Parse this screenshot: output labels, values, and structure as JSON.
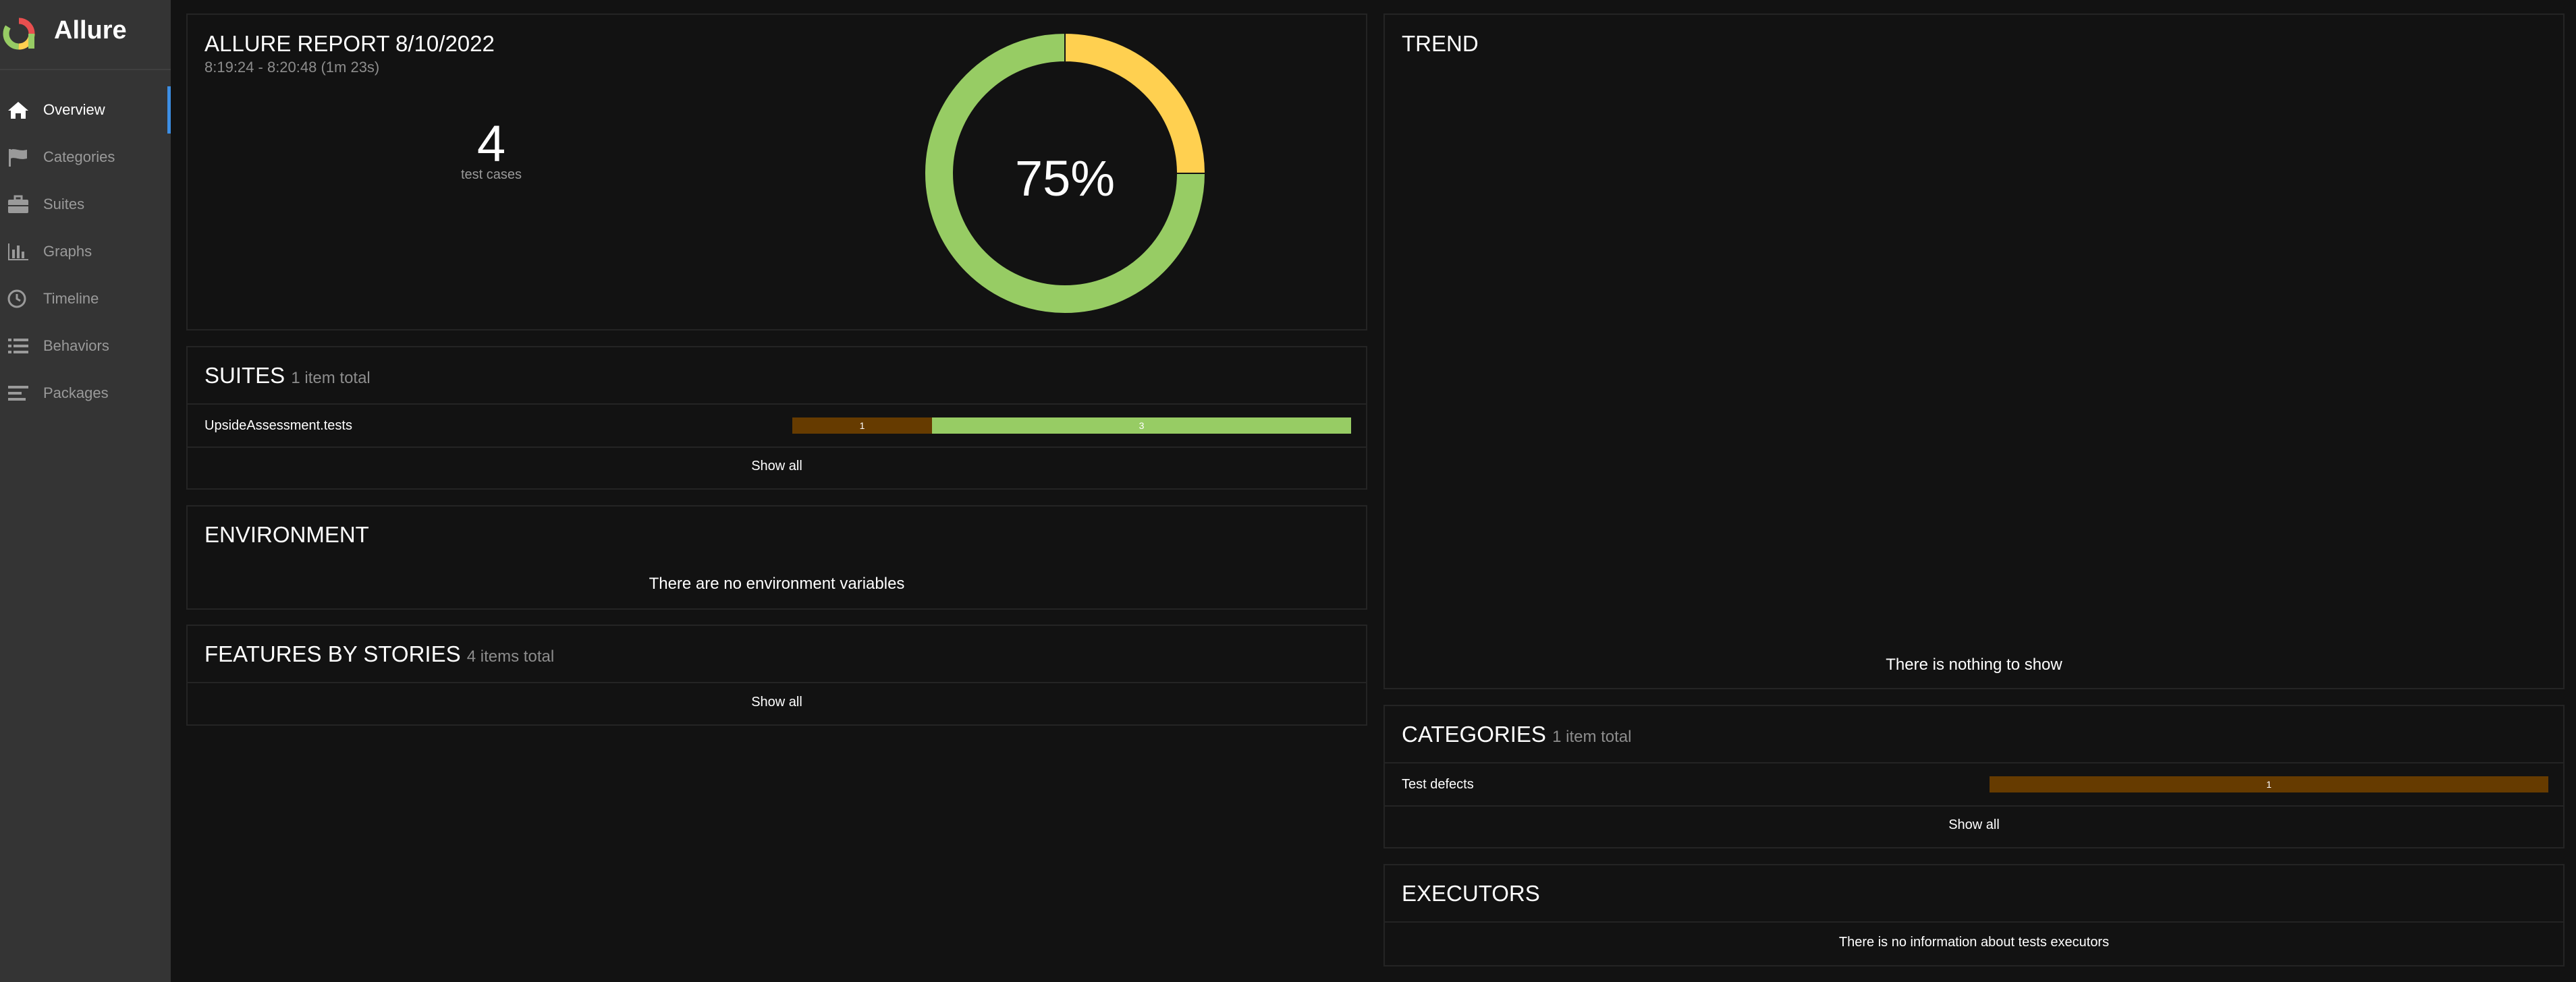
{
  "app": {
    "name": "Allure"
  },
  "colors": {
    "passed": "#97cc64",
    "broken": "#ffd050",
    "defects": "#663b00",
    "accent": "#3d8ee3"
  },
  "sidebar": {
    "items": [
      {
        "label": "Overview",
        "icon": "home-icon",
        "active": true
      },
      {
        "label": "Categories",
        "icon": "flag-icon",
        "active": false
      },
      {
        "label": "Suites",
        "icon": "briefcase-icon",
        "active": false
      },
      {
        "label": "Graphs",
        "icon": "bar-chart-icon",
        "active": false
      },
      {
        "label": "Timeline",
        "icon": "clock-icon",
        "active": false
      },
      {
        "label": "Behaviors",
        "icon": "list-icon",
        "active": false
      },
      {
        "label": "Packages",
        "icon": "align-left-icon",
        "active": false
      }
    ]
  },
  "summary": {
    "title": "ALLURE REPORT 8/10/2022",
    "time": "8:19:24 - 8:20:48 (1m 23s)",
    "count": "4",
    "count_label": "test cases",
    "percent": "75%",
    "donut": {
      "passed_fraction": 0.75,
      "broken_fraction": 0.25
    }
  },
  "suites": {
    "title": "SUITES",
    "count": "1 item total",
    "rows": [
      {
        "name": "UpsideAssessment.tests",
        "broken": 1,
        "passed": 3,
        "broken_label": "1",
        "passed_label": "3"
      }
    ],
    "show_all": "Show all"
  },
  "environment": {
    "title": "ENVIRONMENT",
    "message": "There are no environment variables"
  },
  "features": {
    "title": "FEATURES BY STORIES",
    "count": "4 items total",
    "show_all": "Show all"
  },
  "trend": {
    "title": "TREND",
    "message": "There is nothing to show"
  },
  "categories": {
    "title": "CATEGORIES",
    "count": "1 item total",
    "rows": [
      {
        "name": "Test defects",
        "value_label": "1"
      }
    ],
    "show_all": "Show all"
  },
  "executors": {
    "title": "EXECUTORS",
    "message": "There is no information about tests executors"
  }
}
